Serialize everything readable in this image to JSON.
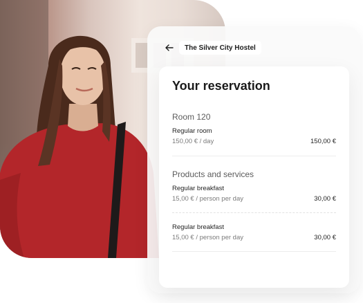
{
  "header": {
    "back_icon": "arrow-left-icon",
    "hostel_name": "The Silver City Hostel"
  },
  "reservation": {
    "title": "Your reservation",
    "room": {
      "section_label": "Room 120",
      "item_name": "Regular room",
      "unit_price": "150,00 € / day",
      "total": "150,00 €"
    },
    "products": {
      "section_label": "Products and services",
      "items": [
        {
          "name": "Regular breakfast",
          "unit_price": "15,00 € / person per day",
          "total": "30,00 €"
        },
        {
          "name": "Regular breakfast",
          "unit_price": "15,00 € / person per day",
          "total": "30,00 €"
        }
      ]
    }
  },
  "colors": {
    "sweater": "#b3262a",
    "hair": "#4a2a1c",
    "skin": "#e8c2a8",
    "card_bg": "#ffffff",
    "panel_bg": "#f7f7f7"
  }
}
